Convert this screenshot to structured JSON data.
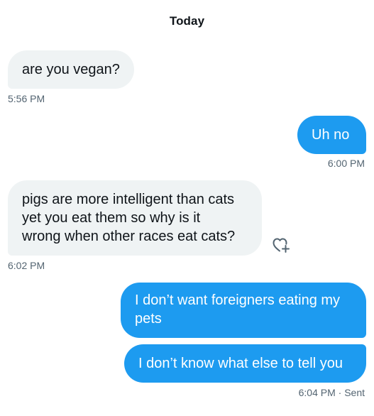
{
  "conversation": {
    "date_header": "Today",
    "messages": [
      {
        "direction": "received",
        "text": "are you vegan?",
        "time": "5:56 PM"
      },
      {
        "direction": "sent",
        "text": "Uh no",
        "time": "6:00 PM"
      },
      {
        "direction": "received",
        "text": "pigs are more intelligent than cats\nyet you eat them so why is it\nwrong when other races eat cats?",
        "time": "6:02 PM",
        "reaction_icon": "add-reaction-heart-icon"
      },
      {
        "direction": "sent",
        "text": "I don’t want foreigners eating my\npets"
      },
      {
        "direction": "sent",
        "text": "I don’t know what else to tell you",
        "time": "6:04 PM · Sent"
      }
    ]
  },
  "colors": {
    "sent_bubble": "#1d9bf0",
    "received_bubble": "#eff3f4",
    "timestamp": "#536471"
  }
}
